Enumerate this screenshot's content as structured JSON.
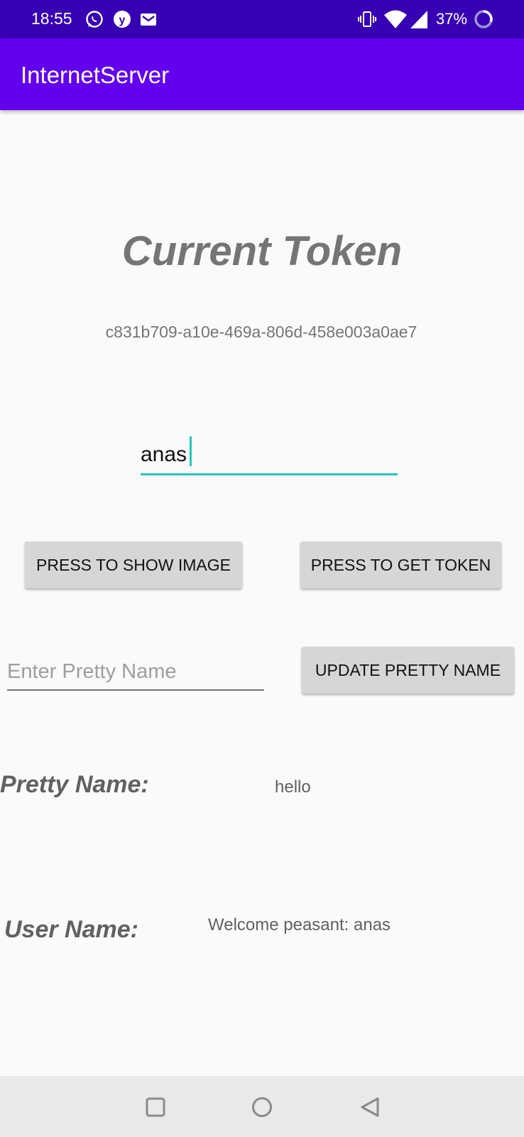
{
  "status_bar": {
    "time": "18:55",
    "notification_icons": [
      "whatsapp-icon",
      "yahoo-icon",
      "gmail-icon"
    ],
    "battery_percent": "37%"
  },
  "app_bar": {
    "title": "InternetServer",
    "color": "#6200ee"
  },
  "token": {
    "heading": "Current Token",
    "value": "c831b709-a10e-469a-806d-458e003a0ae7"
  },
  "name_input": {
    "value": "anas"
  },
  "buttons": {
    "show_image": "PRESS TO SHOW IMAGE",
    "get_token": "PRESS TO GET TOKEN",
    "update_pretty_name": "UPDATE PRETTY NAME"
  },
  "pretty_name_input": {
    "placeholder": "Enter Pretty Name",
    "value": ""
  },
  "pretty_name": {
    "label": "Pretty Name:",
    "value": "hello"
  },
  "user_name": {
    "label": "User Name:",
    "value": "Welcome peasant: anas"
  },
  "nav_bar": {
    "icons": [
      "recents-icon",
      "home-icon",
      "back-icon"
    ]
  }
}
